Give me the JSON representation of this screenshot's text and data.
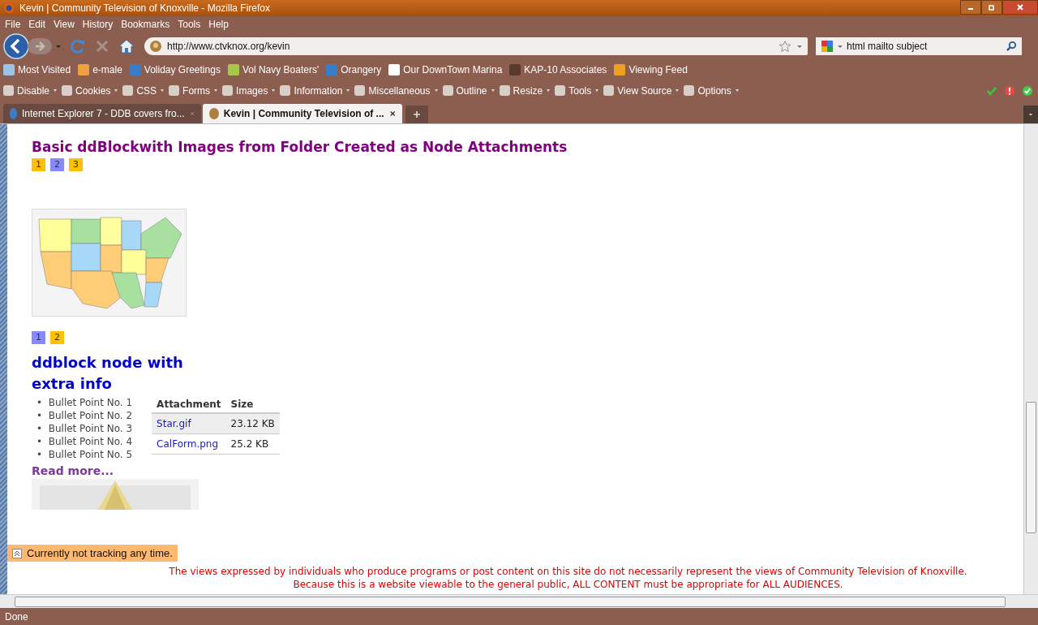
{
  "window": {
    "title": "Kevin | Community Television of Knoxville - Mozilla Firefox"
  },
  "menu": [
    "File",
    "Edit",
    "View",
    "History",
    "Bookmarks",
    "Tools",
    "Help"
  ],
  "address_bar": {
    "url": "http://www.ctvknox.org/kevin"
  },
  "search": {
    "value": "html mailto subject"
  },
  "bookmarks": [
    {
      "label": "Most Visited",
      "kind": "folder"
    },
    {
      "label": "e-male",
      "kind": "pen"
    },
    {
      "label": "Voliday Greetings",
      "kind": "drop"
    },
    {
      "label": "Vol Navy Boaters'"
    },
    {
      "label": "Orangery",
      "kind": "drop"
    },
    {
      "label": "Our DownTown Marina",
      "kind": "page"
    },
    {
      "label": "KAP-10 Associates",
      "kind": "bird"
    },
    {
      "label": "Viewing Feed",
      "kind": "feed"
    }
  ],
  "dev_toolbar": [
    "Disable",
    "Cookies",
    "CSS",
    "Forms",
    "Images",
    "Information",
    "Miscellaneous",
    "Outline",
    "Resize",
    "Tools",
    "View Source",
    "Options"
  ],
  "tabs": [
    {
      "label": "Internet Explorer 7 - DDB covers fro...",
      "selected": false
    },
    {
      "label": "Kevin | Community Television of ...",
      "selected": true
    }
  ],
  "content": {
    "heading": "Basic ddBlockwith Images from Folder Created as Node Attachments",
    "pager_top": [
      {
        "label": "1",
        "selected": false
      },
      {
        "label": "2",
        "selected": true
      },
      {
        "label": "3",
        "selected": false
      }
    ],
    "pager_bottom": [
      {
        "label": "1",
        "selected": true
      },
      {
        "label": "2",
        "selected": false
      }
    ],
    "node_title": "ddblock node with extra info",
    "bullet": "•",
    "bullets": [
      "Bullet Point No. 1",
      "Bullet Point No. 2",
      "Bullet Point No. 3",
      "Bullet Point No. 4",
      "Bullet Point No. 5"
    ],
    "attachments": {
      "columns": [
        "Attachment",
        "Size"
      ],
      "rows": [
        [
          "Star.gif",
          "23.12 KB"
        ],
        [
          "CalForm.png",
          "25.2 KB"
        ]
      ]
    },
    "read_more": "Read more...",
    "footer": [
      "The views expressed by individuals who produce programs or post content on this site do not necessarily represent the views of Community Television of Knoxville.",
      "Because this is a website viewable to the general public, ALL CONTENT must be appropriate for ALL AUDIENCES."
    ]
  },
  "tracking": "Currently not tracking any time.",
  "status": "Done"
}
